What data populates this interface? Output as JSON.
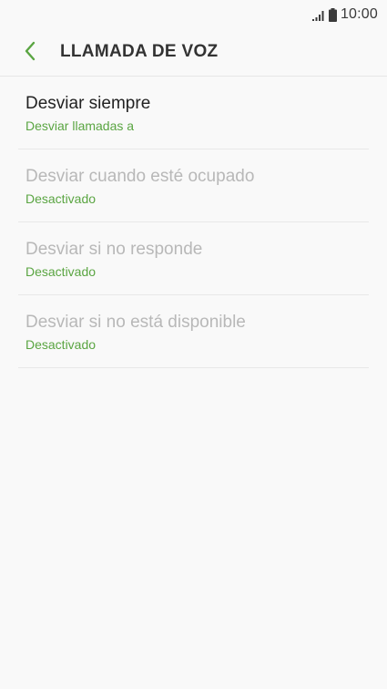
{
  "status_bar": {
    "time": "10:00",
    "signal_icon": "signal-icon",
    "battery_icon": "battery-icon"
  },
  "header": {
    "title": "LLAMADA DE VOZ",
    "back_icon": "back-chevron-icon"
  },
  "colors": {
    "accent": "#5aa542",
    "background": "#f9f9f9",
    "title_text": "#333333",
    "disabled_text": "#b8b8b8"
  },
  "items": [
    {
      "title": "Desviar siempre",
      "subtitle": "Desviar llamadas a",
      "enabled": true
    },
    {
      "title": "Desviar cuando esté ocupado",
      "subtitle": "Desactivado",
      "enabled": false
    },
    {
      "title": "Desviar si no responde",
      "subtitle": "Desactivado",
      "enabled": false
    },
    {
      "title": "Desviar si no está disponible",
      "subtitle": "Desactivado",
      "enabled": false
    }
  ]
}
